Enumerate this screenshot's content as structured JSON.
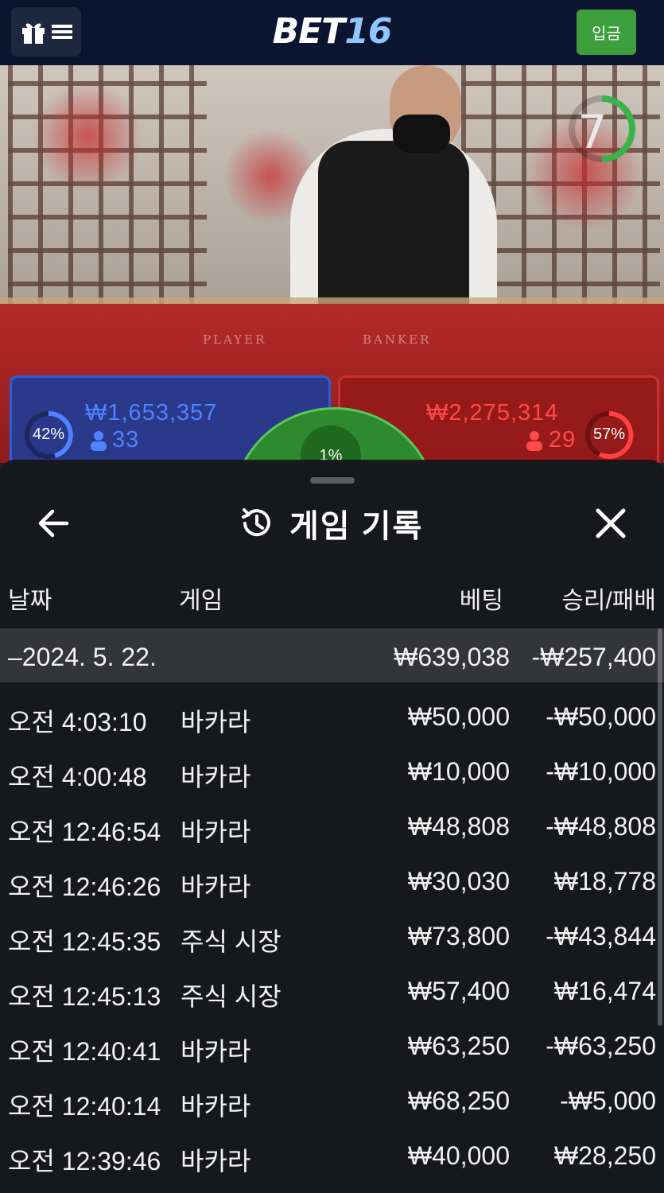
{
  "header": {
    "logo_prefix": "BET",
    "logo_number": "16",
    "deposit_label": "입금",
    "gift_icon": "gift-icon",
    "menu_icon": "menu-icon"
  },
  "live": {
    "felt_player": "PLAYER",
    "felt_banker": "BANKER",
    "timer": "7",
    "player": {
      "percent": "42%",
      "amount": "₩1,653,357",
      "count": "33"
    },
    "banker": {
      "percent": "57%",
      "amount": "₩2,275,314",
      "count": "29"
    },
    "tie": {
      "percent": "1%"
    }
  },
  "sheet": {
    "title": "게임 기록",
    "back_icon": "arrow-left-icon",
    "history_icon": "history-icon",
    "close_icon": "close-icon",
    "columns": {
      "date": "날짜",
      "game": "게임",
      "bet": "베팅",
      "winloss": "승리/패배"
    },
    "summary": {
      "date": "–2024. 5. 22.",
      "bet": "₩639,038",
      "winloss": "-₩257,400"
    },
    "rows": [
      {
        "time": "오전 4:03:10",
        "game": "바카라",
        "bet": "₩50,000",
        "winloss": "-₩50,000"
      },
      {
        "time": "오전 4:00:48",
        "game": "바카라",
        "bet": "₩10,000",
        "winloss": "-₩10,000"
      },
      {
        "time": "오전 12:46:54",
        "game": "바카라",
        "bet": "₩48,808",
        "winloss": "-₩48,808"
      },
      {
        "time": "오전 12:46:26",
        "game": "바카라",
        "bet": "₩30,030",
        "winloss": "₩18,778"
      },
      {
        "time": "오전 12:45:35",
        "game": "주식 시장",
        "bet": "₩73,800",
        "winloss": "-₩43,844"
      },
      {
        "time": "오전 12:45:13",
        "game": "주식 시장",
        "bet": "₩57,400",
        "winloss": "₩16,474"
      },
      {
        "time": "오전 12:40:41",
        "game": "바카라",
        "bet": "₩63,250",
        "winloss": "-₩63,250"
      },
      {
        "time": "오전 12:40:14",
        "game": "바카라",
        "bet": "₩68,250",
        "winloss": "-₩5,000"
      },
      {
        "time": "오전 12:39:46",
        "game": "바카라",
        "bet": "₩40,000",
        "winloss": "₩28,250"
      }
    ]
  },
  "colors": {
    "deposit": "#3c9f3c",
    "player": "#2b5ed6",
    "banker": "#c93030",
    "tie": "#2e8a2e"
  }
}
